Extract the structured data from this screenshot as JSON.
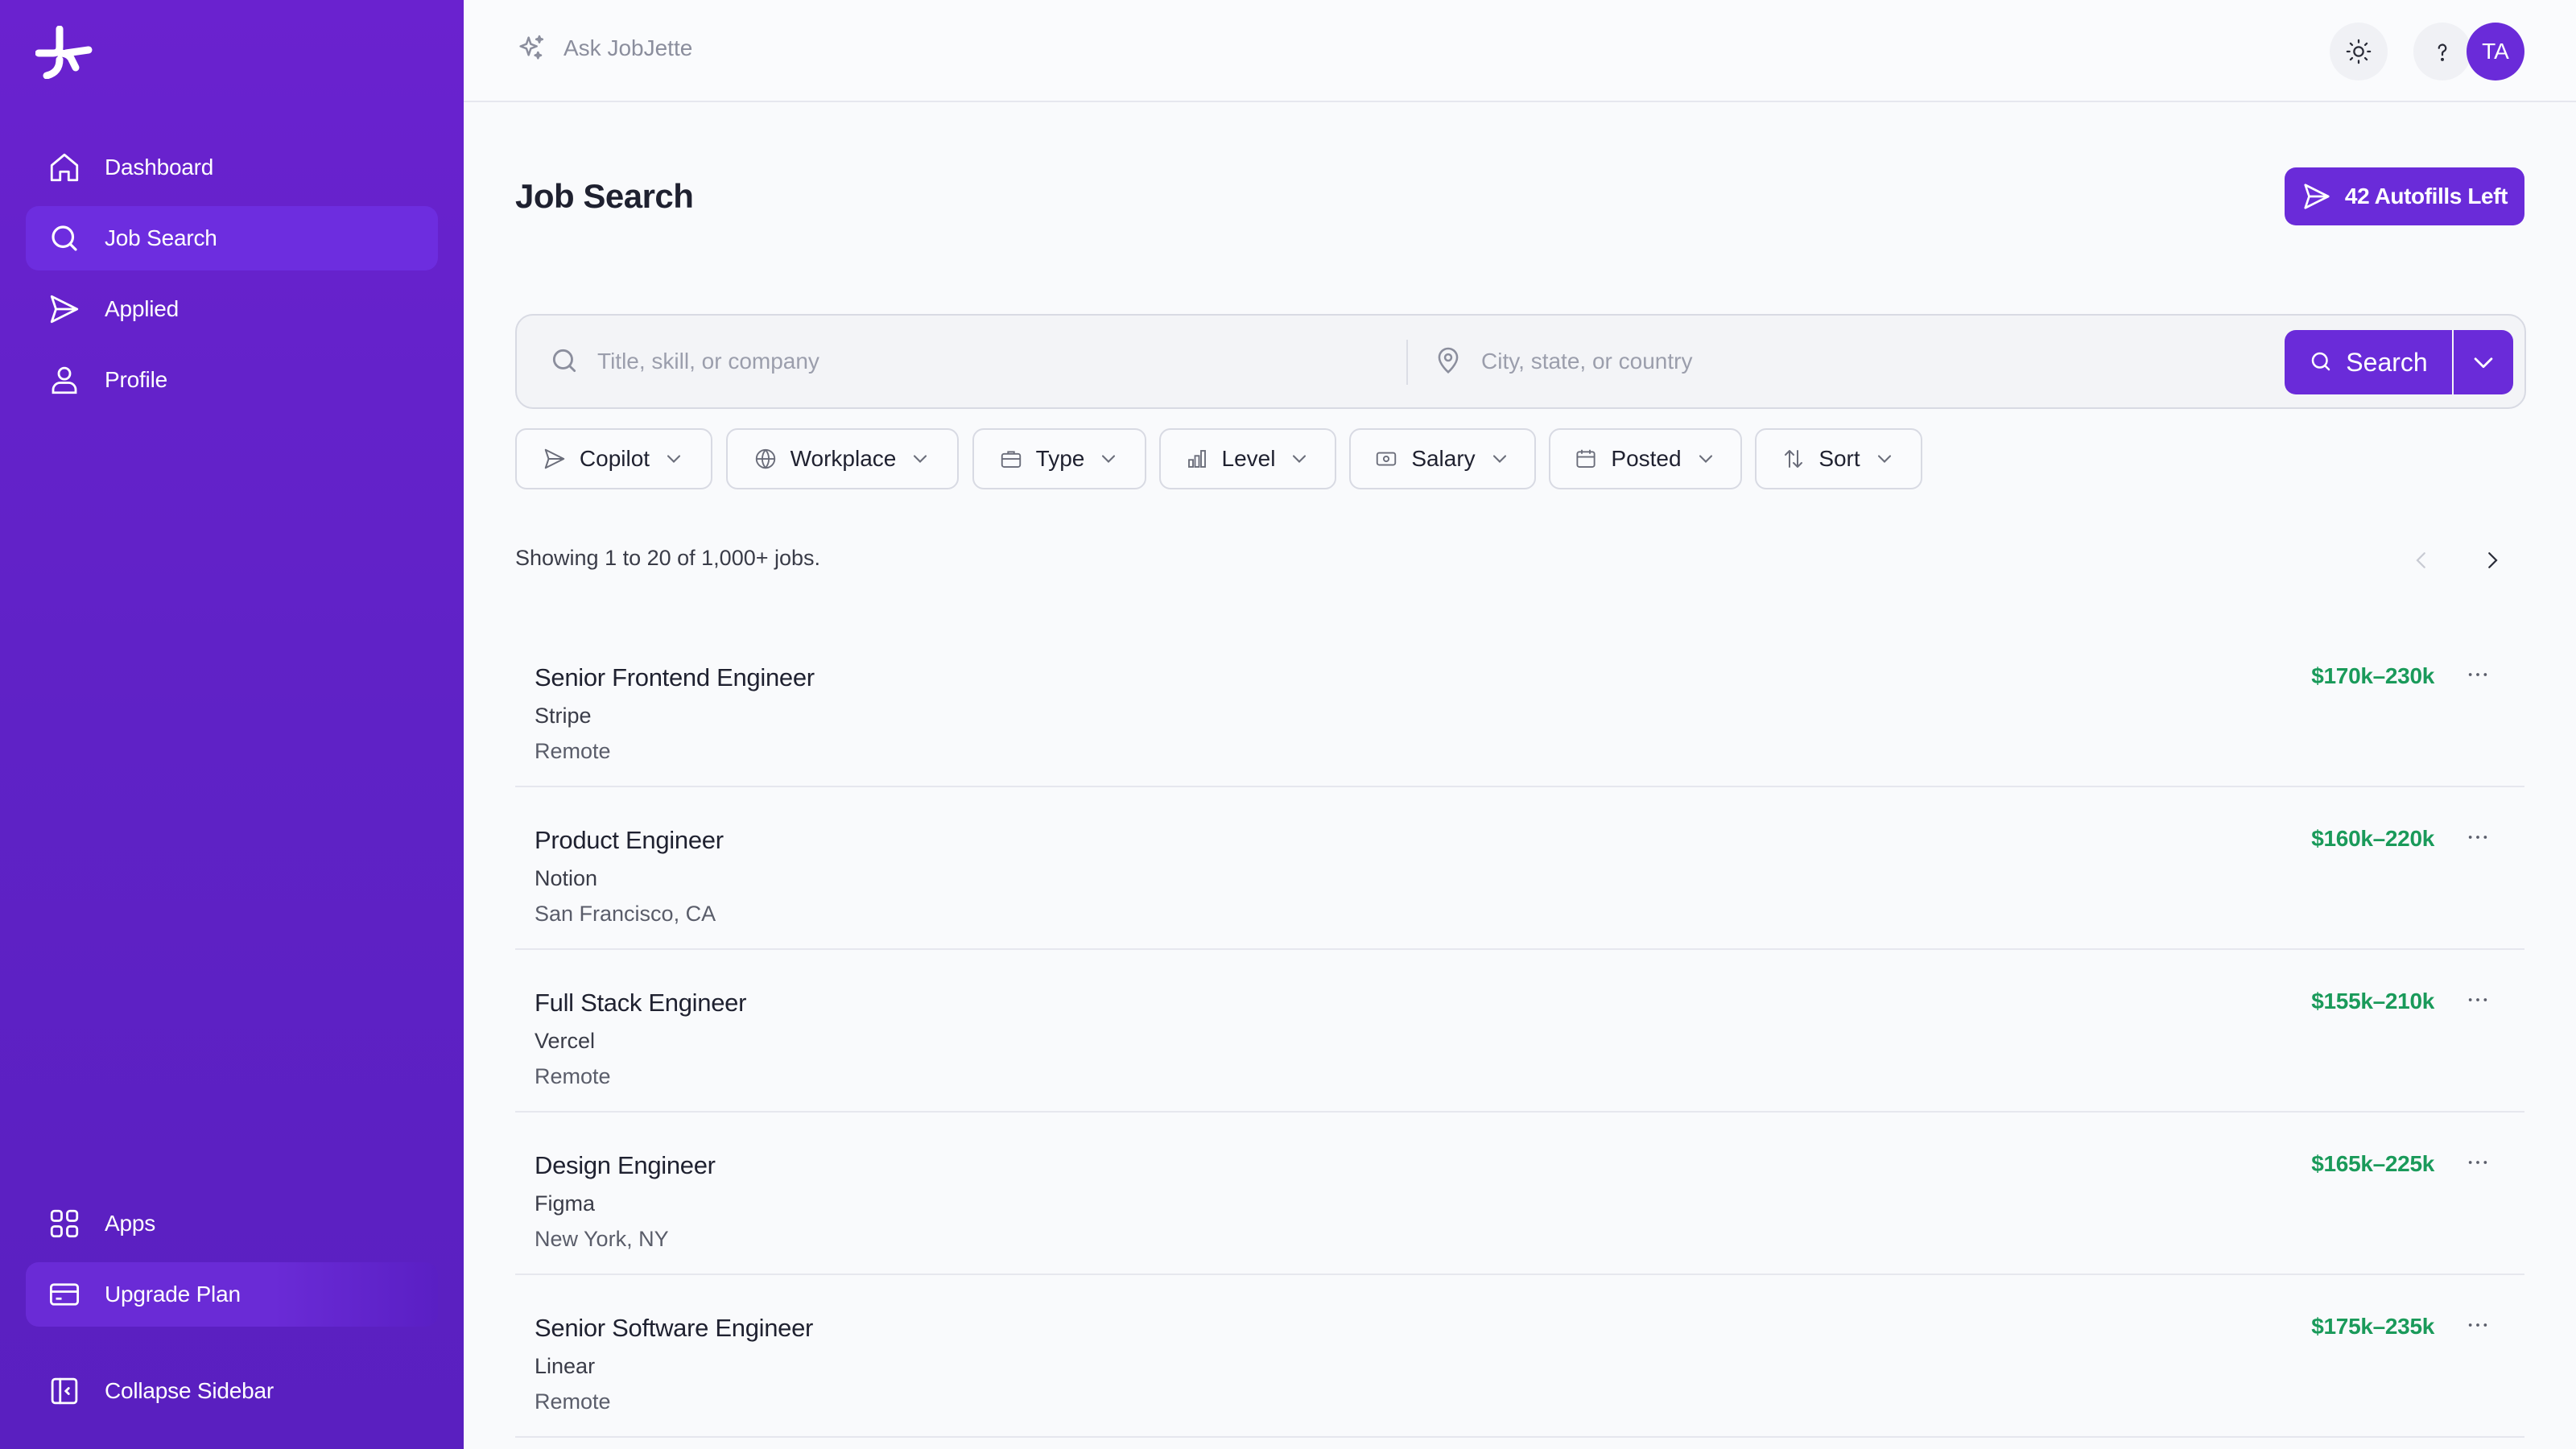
{
  "sidebar": {
    "items": [
      {
        "label": "Dashboard",
        "icon": "home-icon"
      },
      {
        "label": "Job Search",
        "icon": "search-icon",
        "active": true
      },
      {
        "label": "Applied",
        "icon": "send-icon"
      },
      {
        "label": "Profile",
        "icon": "user-icon"
      }
    ],
    "bottom": [
      {
        "label": "Apps",
        "icon": "grid-icon"
      },
      {
        "label": "Upgrade Plan",
        "icon": "credit-card-icon"
      },
      {
        "label": "Collapse Sidebar",
        "icon": "collapse-sidebar-icon"
      }
    ]
  },
  "topbar": {
    "ask_label": "Ask JobJette",
    "avatar_initials": "TA"
  },
  "main": {
    "title": "Job Search",
    "autofill_label": "42 Autofills Left",
    "search": {
      "query_placeholder": "Title, skill, or company",
      "location_placeholder": "City, state, or country",
      "button_label": "Search"
    },
    "filters": [
      "Copilot",
      "Workplace",
      "Type",
      "Level",
      "Salary",
      "Posted",
      "Sort"
    ],
    "showing_text": "Showing 1 to 20 of 1,000+ jobs.",
    "jobs": [
      {
        "title": "Senior Frontend Engineer",
        "company": "Stripe",
        "location": "Remote",
        "salary": "$170k–230k"
      },
      {
        "title": "Product Engineer",
        "company": "Notion",
        "location": "San Francisco, CA",
        "salary": "$160k–220k"
      },
      {
        "title": "Full Stack Engineer",
        "company": "Vercel",
        "location": "Remote",
        "salary": "$155k–210k"
      },
      {
        "title": "Design Engineer",
        "company": "Figma",
        "location": "New York, NY",
        "salary": "$165k–225k"
      },
      {
        "title": "Senior Software Engineer",
        "company": "Linear",
        "location": "Remote",
        "salary": "$175k–235k"
      }
    ]
  },
  "colors": {
    "brand": "#6a2bd9",
    "sidebar_bg": "#5f22c6",
    "salary_green": "#1a9a5a"
  }
}
